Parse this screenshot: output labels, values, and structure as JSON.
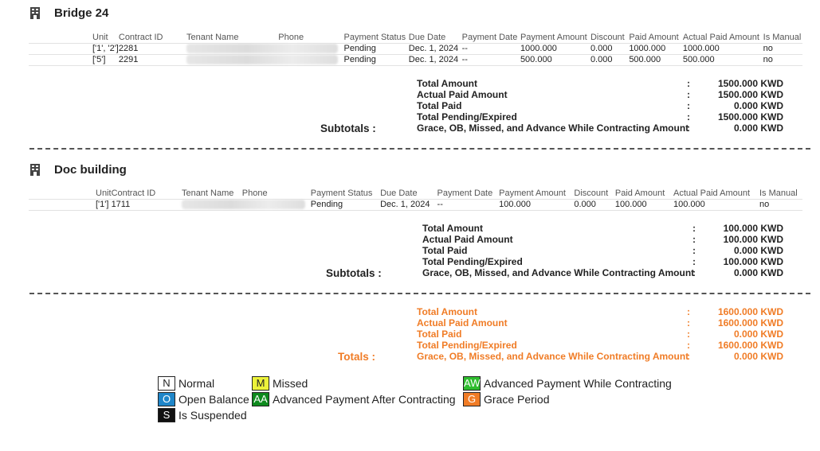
{
  "table_headers": [
    "Unit",
    "Contract ID",
    "Tenant Name",
    "Phone",
    "Payment Status",
    "Due Date",
    "Payment Date",
    "Payment Amount",
    "Discount",
    "Paid Amount",
    "Actual Paid Amount",
    "Is Manual"
  ],
  "buildings": [
    {
      "name": "Bridge 24",
      "rows": [
        {
          "unit": "['1', '2']",
          "contract_id": "2281",
          "tenant_name": "",
          "phone": "",
          "status": "Pending",
          "due_date": "Dec. 1, 2024",
          "payment_date": "--",
          "payment_amount": "1000.000",
          "discount": "0.000",
          "paid_amount": "1000.000",
          "actual_paid_amount": "1000.000",
          "is_manual": "no"
        },
        {
          "unit": "['5']",
          "contract_id": "2291",
          "tenant_name": "",
          "phone": "",
          "status": "Pending",
          "due_date": "Dec. 1, 2024",
          "payment_date": "--",
          "payment_amount": "500.000",
          "discount": "0.000",
          "paid_amount": "500.000",
          "actual_paid_amount": "500.000",
          "is_manual": "no"
        }
      ],
      "subtotals_label": "Subtotals :",
      "summary": [
        {
          "label": "Total Amount",
          "value": "1500.000 KWD"
        },
        {
          "label": "Actual Paid Amount",
          "value": "1500.000 KWD"
        },
        {
          "label": "Total Paid",
          "value": "0.000 KWD"
        },
        {
          "label": "Total Pending/Expired",
          "value": "1500.000 KWD"
        },
        {
          "label": "Grace, OB, Missed, and Advance While Contracting Amount",
          "value": "0.000 KWD"
        }
      ]
    },
    {
      "name": "Doc building",
      "rows": [
        {
          "unit": "['1']",
          "contract_id": "1711",
          "tenant_name": "",
          "phone": "",
          "status": "Pending",
          "due_date": "Dec. 1, 2024",
          "payment_date": "--",
          "payment_amount": "100.000",
          "discount": "0.000",
          "paid_amount": "100.000",
          "actual_paid_amount": "100.000",
          "is_manual": "no"
        }
      ],
      "subtotals_label": "Subtotals :",
      "summary": [
        {
          "label": "Total Amount",
          "value": "100.000 KWD"
        },
        {
          "label": "Actual Paid Amount",
          "value": "100.000 KWD"
        },
        {
          "label": "Total Paid",
          "value": "0.000 KWD"
        },
        {
          "label": "Total Pending/Expired",
          "value": "100.000 KWD"
        },
        {
          "label": "Grace, OB, Missed, and Advance While Contracting Amount",
          "value": "0.000 KWD"
        }
      ]
    }
  ],
  "totals": {
    "label": "Totals :",
    "summary": [
      {
        "label": "Total Amount",
        "value": "1600.000 KWD"
      },
      {
        "label": "Actual Paid Amount",
        "value": "1600.000 KWD"
      },
      {
        "label": "Total Paid",
        "value": "0.000 KWD"
      },
      {
        "label": "Total Pending/Expired",
        "value": "1600.000 KWD"
      },
      {
        "label": "Grace, OB, Missed, and Advance While Contracting Amount",
        "value": "0.000 KWD"
      }
    ]
  },
  "colon": ":",
  "legend": [
    {
      "code": "N",
      "label": "Normal",
      "bg": "#ffffff",
      "fg": "#222222"
    },
    {
      "code": "M",
      "label": "Missed",
      "bg": "#ecf23a",
      "fg": "#222222"
    },
    {
      "code": "AW",
      "label": "Advanced Payment While Contracting",
      "bg": "#2ebd2e",
      "fg": "#ffffff"
    },
    {
      "code": "O",
      "label": "Open Balance",
      "bg": "#1f86c9",
      "fg": "#ffffff"
    },
    {
      "code": "AA",
      "label": "Advanced Payment After Contracting",
      "bg": "#0e8a1e",
      "fg": "#ffffff"
    },
    {
      "code": "G",
      "label": "Grace Period",
      "bg": "#f07c26",
      "fg": "#ffffff"
    },
    {
      "code": "S",
      "label": "Is Suspended",
      "bg": "#111111",
      "fg": "#ffffff"
    }
  ],
  "colors": {
    "pending": "#f07c26",
    "totals": "#f07c26"
  }
}
